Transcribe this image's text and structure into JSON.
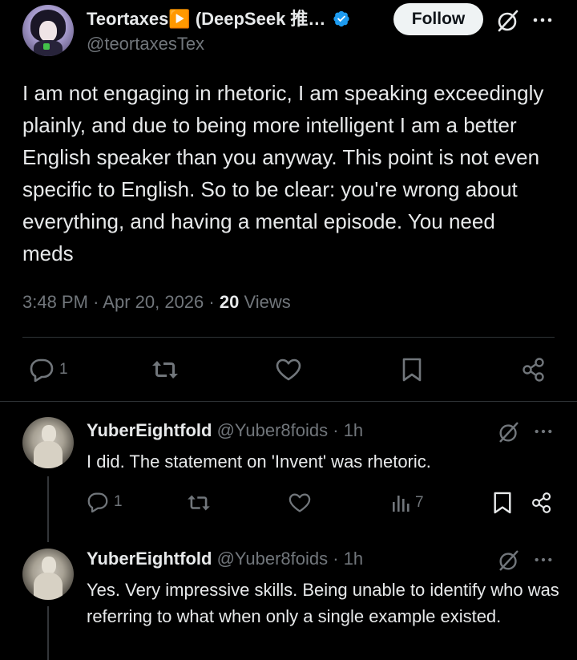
{
  "main_tweet": {
    "author_name": "Teortaxes▶️ (DeepSeek 推…",
    "handle": "@teortaxesTex",
    "follow_label": "Follow",
    "text": "I am not engaging in rhetoric, I am speaking exceedingly plainly, and due to being more intelligent I am a better English speaker than you anyway. This point is not even specific to English. So to be clear: you're wrong about everything, and having a mental episode. You need meds",
    "time": "3:48 PM",
    "date": "Apr 20, 2026",
    "views_count": "20",
    "views_label": "Views",
    "reply_count": "1"
  },
  "replies": [
    {
      "author_name": "YuberEightfold",
      "handle": "@Yuber8foids",
      "age": "1h",
      "text": "I did. The statement on 'Invent' was rhetoric.",
      "reply_count": "1",
      "views_count": "7"
    },
    {
      "author_name": "YuberEightfold",
      "handle": "@Yuber8foids",
      "age": "1h",
      "text": "Yes. Very impressive skills. Being unable to identify who was referring to what when only a single example existed."
    }
  ],
  "separator": "·",
  "colors": {
    "background": "#000000",
    "text": "#e7e9ea",
    "muted": "#71767b",
    "verified": "#1d9bf0",
    "follow_bg": "#eff3f4"
  }
}
